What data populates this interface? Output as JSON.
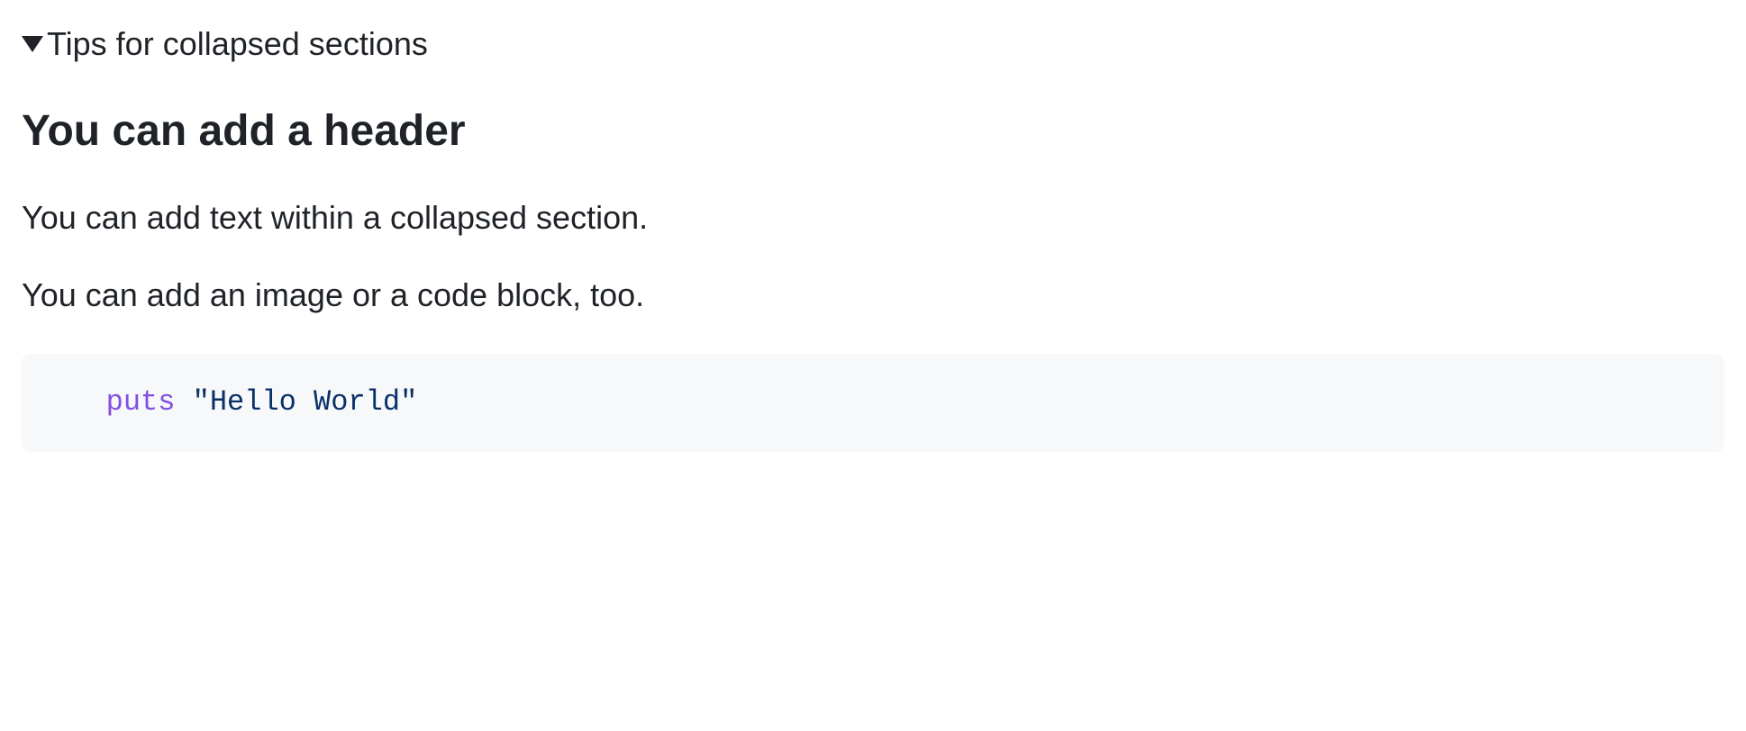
{
  "summary": {
    "label": "Tips for collapsed sections"
  },
  "content": {
    "heading": "You can add a header",
    "paragraph1": "You can add text within a collapsed section.",
    "paragraph2": "You can add an image or a code block, too.",
    "code": {
      "keyword": "puts",
      "string": "\"Hello World\""
    }
  }
}
